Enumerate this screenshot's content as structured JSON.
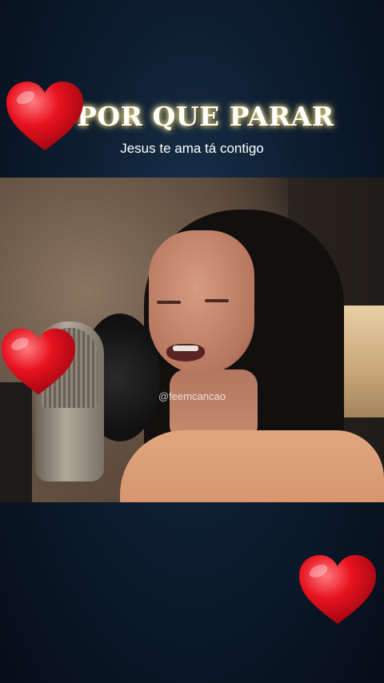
{
  "banner": {
    "title": "POR QUE PARAR",
    "subtitle": "Jesus te ama tá contigo"
  },
  "video": {
    "watermark": "@feemcancao"
  },
  "decorations": {
    "heart_icon": "heart-icon",
    "heart_color": "#e8121f"
  }
}
